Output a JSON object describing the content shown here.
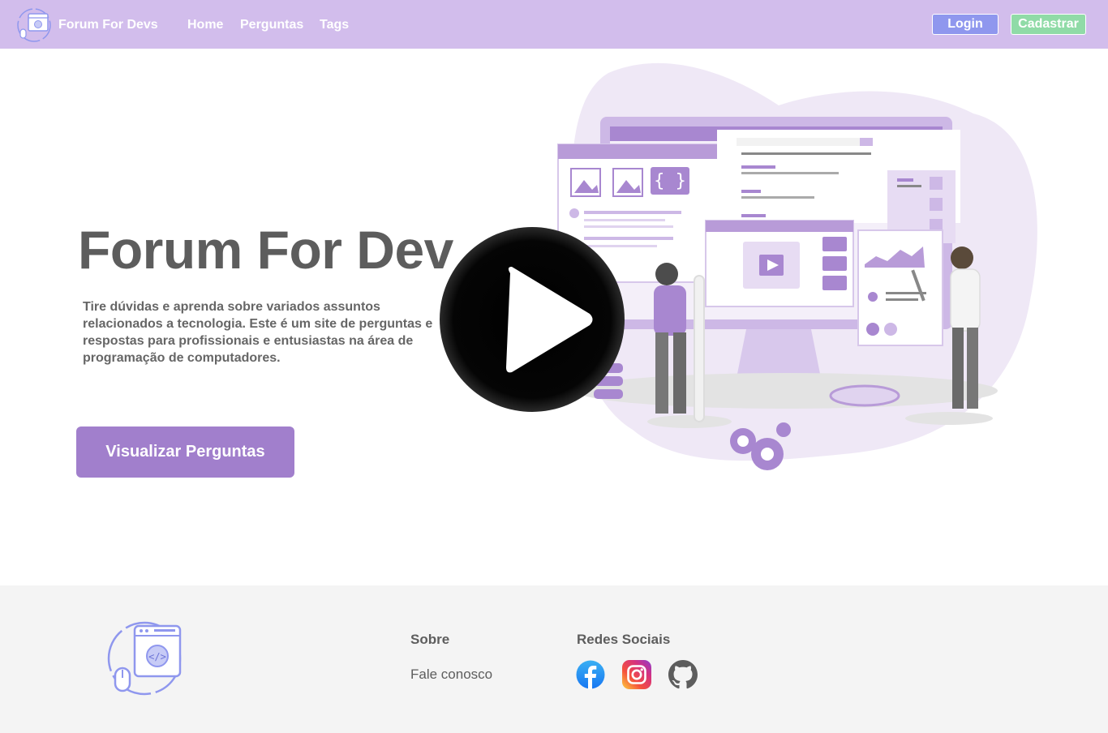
{
  "navbar": {
    "brand_name": "Forum For Devs",
    "links": [
      "Home",
      "Perguntas",
      "Tags"
    ],
    "login_label": "Login",
    "cadastrar_label": "Cadastrar"
  },
  "hero": {
    "title": "Forum For Dev",
    "description": "Tire dúvidas e aprenda sobre variados assuntos relacionados a tecnologia. Este é um site de perguntas e respostas para profissionais e entusiastas na área de programação de computadores.",
    "button_label": "Visualizar Perguntas",
    "illustration_icon": "developer-team-illustration",
    "play_icon": "play-icon"
  },
  "footer": {
    "sobre_heading": "Sobre",
    "sobre_link": "Fale conosco",
    "redes_heading": "Redes Sociais",
    "socials": [
      "facebook-icon",
      "instagram-icon",
      "github-icon"
    ]
  },
  "colors": {
    "navbar_bg": "#d2bdec",
    "login_bg": "#8f97ee",
    "cadastrar_bg": "#90dba7",
    "hero_button_bg": "#a17fcc",
    "text_gray": "#5d5d5d",
    "footer_bg": "#f4f4f4"
  }
}
